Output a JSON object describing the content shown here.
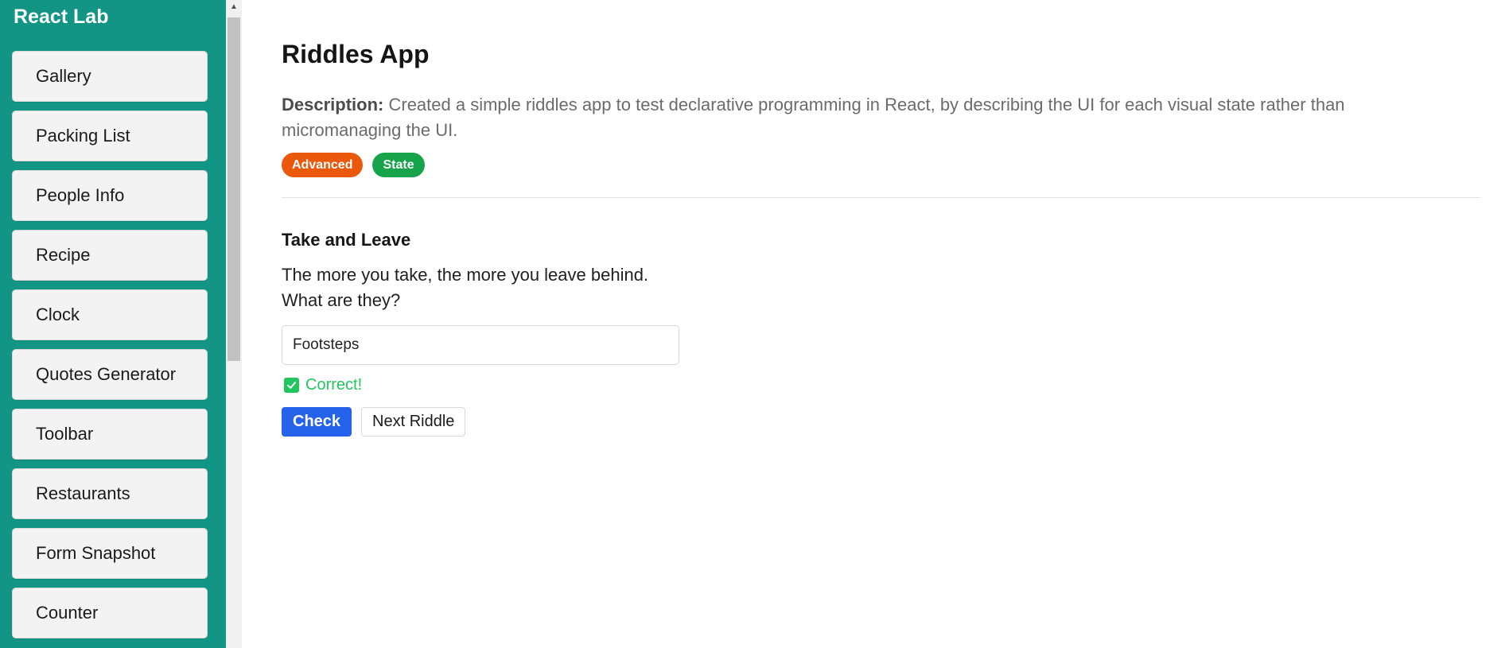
{
  "sidebar": {
    "title": "React Lab",
    "background": "#129584",
    "items": [
      {
        "label": "Gallery",
        "key": "gallery"
      },
      {
        "label": "Packing List",
        "key": "packing-list"
      },
      {
        "label": "People Info",
        "key": "people-info"
      },
      {
        "label": "Recipe",
        "key": "recipe"
      },
      {
        "label": "Clock",
        "key": "clock"
      },
      {
        "label": "Quotes Generator",
        "key": "quotes-generator"
      },
      {
        "label": "Toolbar",
        "key": "toolbar"
      },
      {
        "label": "Restaurants",
        "key": "restaurants"
      },
      {
        "label": "Form Snapshot",
        "key": "form-snapshot"
      },
      {
        "label": "Counter",
        "key": "counter"
      }
    ]
  },
  "main": {
    "title": "Riddles App",
    "description_label": "Description:",
    "description_text": "Created a simple riddles app to test declarative programming in React, by describing the UI for each visual state rather than micromanaging the UI.",
    "tags": [
      {
        "label": "Advanced",
        "color": "#ea580c"
      },
      {
        "label": "State",
        "color": "#16a34a"
      }
    ],
    "riddle": {
      "title": "Take and Leave",
      "question_line1": "The more you take, the more you leave behind.",
      "question_line2": "What are they?",
      "answer_value": "Footsteps",
      "feedback": "Correct!",
      "feedback_icon": "checkbox-checked-icon",
      "feedback_color": "#22c55e"
    },
    "buttons": {
      "check": "Check",
      "next": "Next Riddle"
    }
  }
}
